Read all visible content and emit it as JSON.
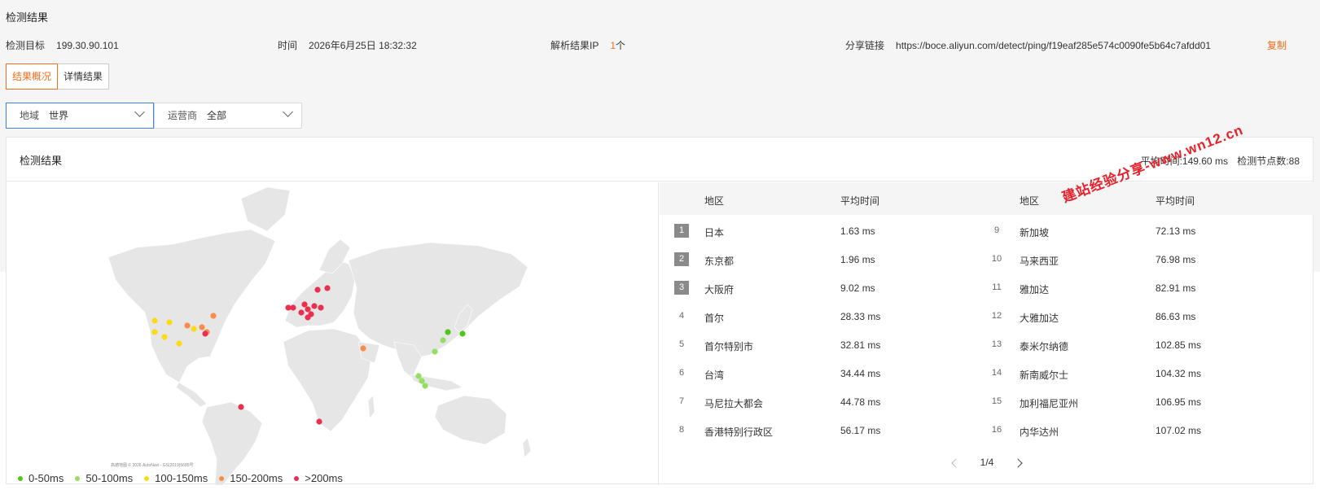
{
  "section_title": "检测结果",
  "info": {
    "target_label": "检测目标",
    "target_value": "199.30.90.101",
    "time_label": "时间",
    "time_value": "2026年6月25日 18:32:32",
    "ip_label": "解析结果IP",
    "ip_count": "1",
    "ip_unit": "个",
    "share_label": "分享链接",
    "share_url": "https://boce.aliyun.com/detect/ping/f19eaf285e574c0090fe5b64c7afdd01",
    "copy_label": "复制"
  },
  "tabs": [
    {
      "label": "结果概况",
      "active": true
    },
    {
      "label": "详情结果",
      "active": false
    }
  ],
  "filters": {
    "region_label": "地域",
    "region_value": "世界",
    "isp_label": "运营商",
    "isp_value": "全部"
  },
  "results": {
    "title": "检测结果",
    "avg_label": "平均时间:",
    "avg_value": "149.60 ms",
    "nodes_label": "检测节点数:",
    "nodes_value": "88",
    "headers": {
      "region": "地区",
      "avg": "平均时间"
    },
    "left": [
      {
        "rank": "1",
        "region": "日本",
        "avg": "1.63 ms"
      },
      {
        "rank": "2",
        "region": "东京都",
        "avg": "1.96 ms"
      },
      {
        "rank": "3",
        "region": "大阪府",
        "avg": "9.02 ms"
      },
      {
        "rank": "4",
        "region": "首尔",
        "avg": "28.33 ms"
      },
      {
        "rank": "5",
        "region": "首尔特别市",
        "avg": "32.81 ms"
      },
      {
        "rank": "6",
        "region": "台湾",
        "avg": "34.44 ms"
      },
      {
        "rank": "7",
        "region": "马尼拉大都会",
        "avg": "44.78 ms"
      },
      {
        "rank": "8",
        "region": "香港特别行政区",
        "avg": "56.17 ms"
      }
    ],
    "right": [
      {
        "rank": "9",
        "region": "新加坡",
        "avg": "72.13 ms"
      },
      {
        "rank": "10",
        "region": "马来西亚",
        "avg": "76.98 ms"
      },
      {
        "rank": "11",
        "region": "雅加达",
        "avg": "82.91 ms"
      },
      {
        "rank": "12",
        "region": "大雅加达",
        "avg": "86.63 ms"
      },
      {
        "rank": "13",
        "region": "泰米尔纳德",
        "avg": "102.85 ms"
      },
      {
        "rank": "14",
        "region": "新南威尔士",
        "avg": "104.32 ms"
      },
      {
        "rank": "15",
        "region": "加利福尼亚州",
        "avg": "106.95 ms"
      },
      {
        "rank": "16",
        "region": "内华达州",
        "avg": "107.02 ms"
      }
    ],
    "page": "1/4"
  },
  "legend": [
    {
      "label": "0-50ms",
      "color": "#52c41a"
    },
    {
      "label": "50-100ms",
      "color": "#95de64"
    },
    {
      "label": "100-150ms",
      "color": "#fadb14"
    },
    {
      "label": "150-200ms",
      "color": "#fa8c4b"
    },
    {
      "label": ">200ms",
      "color": "#eb2f4f"
    }
  ],
  "map_attribution": "高德地图 © 2026 AutoNavi - GS(2019)5685号",
  "watermark": "建站经验分享-www.wn12.cn"
}
